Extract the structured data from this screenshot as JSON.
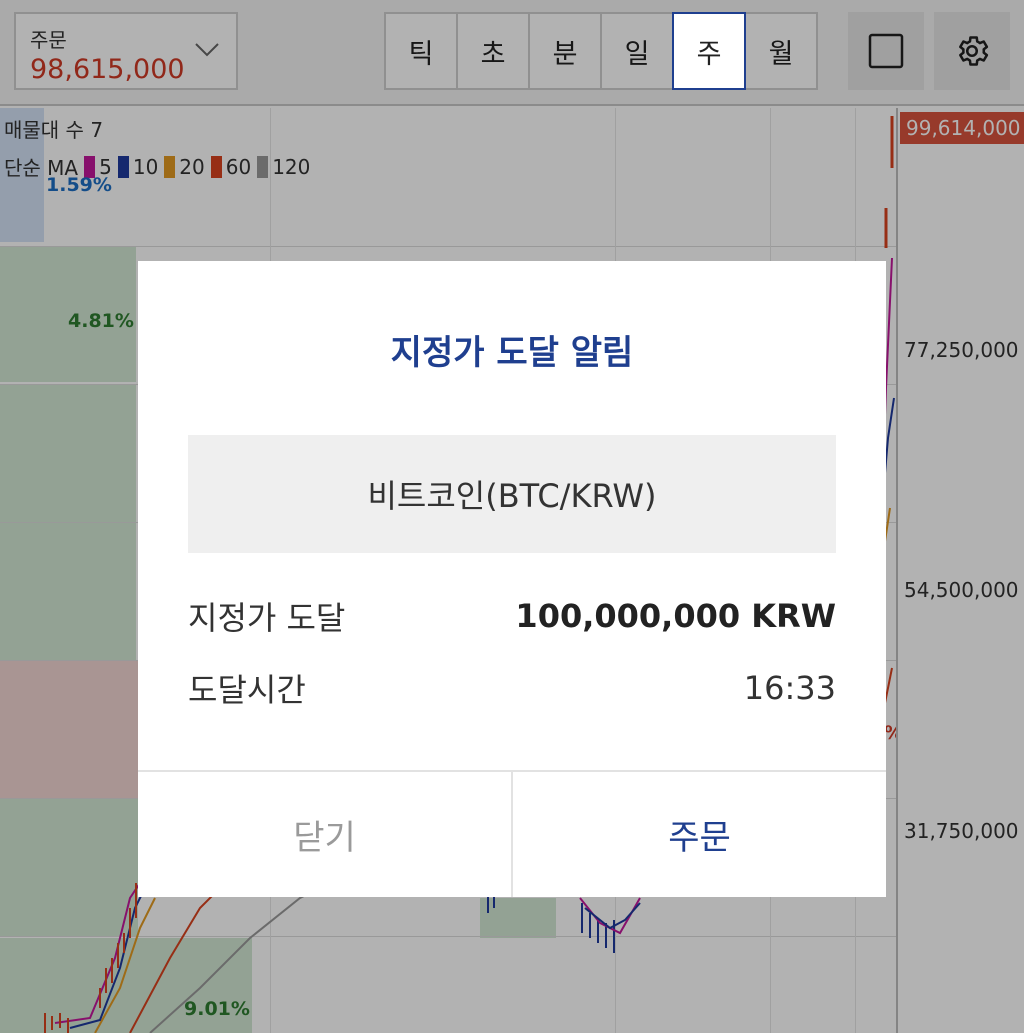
{
  "topbar": {
    "order_label": "주문",
    "order_price": "98,615,000",
    "periods": [
      "틱",
      "초",
      "분",
      "일",
      "주",
      "월"
    ],
    "active_period": "주"
  },
  "chart": {
    "title": "매물대 수 7",
    "ma_label": "단순 MA",
    "ma": [
      {
        "period": "5",
        "color": "#c2189b"
      },
      {
        "period": "10",
        "color": "#1f3a9e"
      },
      {
        "period": "20",
        "color": "#e29a22"
      },
      {
        "period": "60",
        "color": "#d8431f"
      },
      {
        "period": "120",
        "color": "#9a9a9a"
      }
    ],
    "current_price": "99,614,000",
    "y_axis_labels": [
      "77,250,000",
      "54,500,000",
      "31,750,000"
    ],
    "volume_profile": [
      "1.59%",
      "4.81%",
      "9.01%",
      "%"
    ]
  },
  "dialog": {
    "title": "지정가 도달 알림",
    "asset": "비트코인(BTC/KRW)",
    "price_label": "지정가 도달",
    "price_value": "100,000,000 KRW",
    "time_label": "도달시간",
    "time_value": "16:33",
    "close_label": "닫기",
    "order_label": "주문"
  },
  "colors": {
    "brand_navy": "#1f3f8f",
    "price_red": "#d03a26",
    "volume_green": "#2e7d32",
    "volume_blue": "#1e6fc4"
  }
}
